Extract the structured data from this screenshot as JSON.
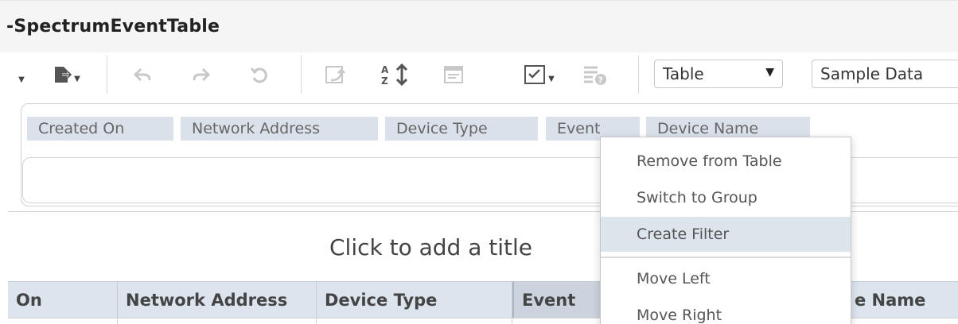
{
  "window": {
    "title": "-SpectrumEventTable"
  },
  "toolbar": {
    "buttons": [
      {
        "icon": "caret-down-icon"
      },
      {
        "icon": "export-icon"
      },
      {
        "icon": "undo-icon"
      },
      {
        "icon": "redo-icon"
      },
      {
        "icon": "reset-icon"
      },
      {
        "icon": "swap-icon"
      },
      {
        "icon": "sort-icon"
      },
      {
        "icon": "table-format-icon"
      },
      {
        "icon": "checklist-icon"
      },
      {
        "icon": "conditional-format-icon"
      }
    ],
    "view_select": {
      "value": "Table"
    },
    "data_select": {
      "value": "Sample Data"
    }
  },
  "columns_panel": {
    "chips": [
      "Created On",
      "Network Address",
      "Device Type",
      "Event",
      "Device Name"
    ]
  },
  "table": {
    "title_placeholder": "Click to add a title",
    "headers": [
      "On",
      "Network Address",
      "Device Type",
      "Event",
      "e Name"
    ]
  },
  "context_menu": {
    "items": [
      "Remove from Table",
      "Switch to Group",
      "Create Filter",
      "Move Left",
      "Move Right"
    ],
    "hovered": "Create Filter"
  },
  "colors": {
    "chip_bg": "#dae1ea",
    "header_bg": "#dce4ee",
    "menu_hover": "#dce4ec"
  }
}
